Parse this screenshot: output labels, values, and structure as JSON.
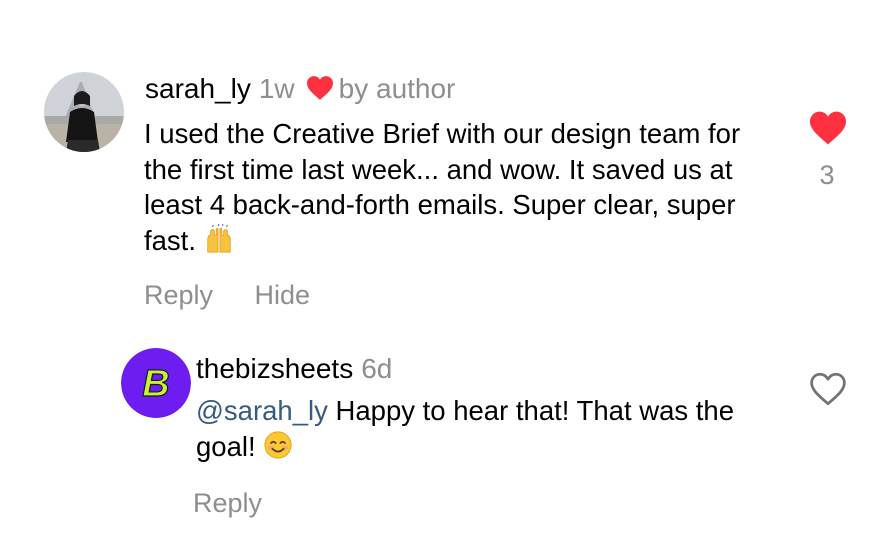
{
  "comment": {
    "username": "sarah_ly",
    "time": "1w",
    "author_badge": "by author",
    "text": "I used the Creative Brief with our design team for the first time last week... and wow. It saved us at least 4 back-and-forth emails. Super clear, super fast.",
    "emoji": "raising-hands",
    "actions": {
      "reply": "Reply",
      "hide": "Hide"
    },
    "likes": "3",
    "liked": true
  },
  "reply": {
    "username": "thebizsheets",
    "time": "6d",
    "mention": "@sarah_ly",
    "text": "Happy to hear that! That was the goal!",
    "emoji": "smiling-face-with-smiling-eyes",
    "avatar_letter": "B",
    "actions": {
      "reply": "Reply"
    },
    "liked": false
  },
  "colors": {
    "heart_red": "#ff3040",
    "meta_gray": "#8e8e8e",
    "mention_blue": "#375a7f",
    "brand_purple": "#6e1df0",
    "brand_lime": "#c7f23a"
  }
}
